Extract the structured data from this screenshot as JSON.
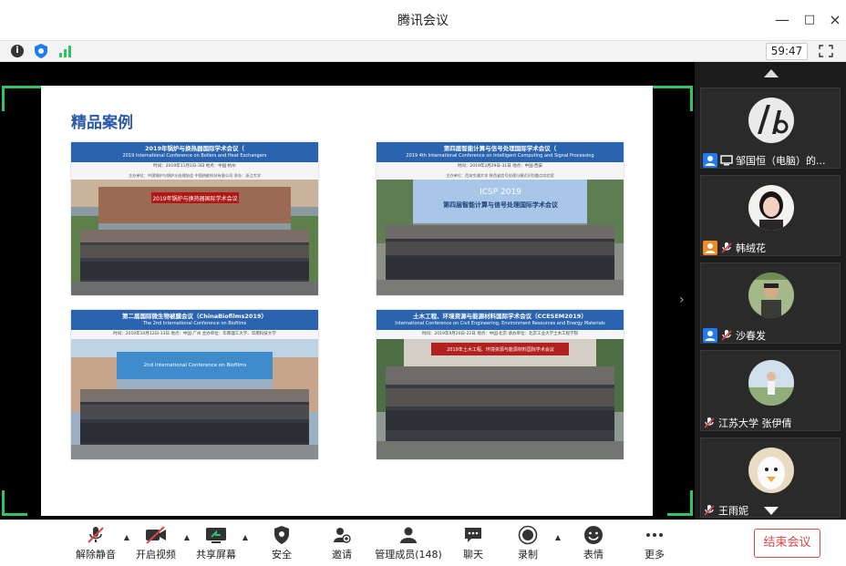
{
  "window": {
    "title": "腾讯会议",
    "min": "—",
    "max": "□",
    "close": "×"
  },
  "toolbar": {
    "timer": "59:47",
    "info": "i"
  },
  "slide": {
    "title": "精品案例",
    "cases": [
      {
        "cn": "2019年锅炉与换热器国际学术会议（",
        "en": "2019 International Conference on Boilers and Heat Exchangers",
        "meta": "时间：2019年11月1日-3日    地点：中国·杭州",
        "meta2": "主办单位：中国锅炉与锅炉水处理协会    中国热能科技有限公司    承办：浙江大学",
        "banner": "2019年锅炉与换热器国际学术会议"
      },
      {
        "cn": "第四届智能计算与信号处理国际学术会议（",
        "en": "2019 4th International Conference on Intelligent Computing and Signal Processing",
        "meta": "时间：2019年3月29日-31日    地点：中国·西安",
        "meta2": "主办单位：西安交通大学    陕西省信号处理与模式识别重点实验室",
        "banner": "ICSP 2019",
        "banner2": "第四届智能计算与信号处理国际学术会议"
      },
      {
        "cn": "第二届国际微生物被膜会议（ChinaBiofilms2019）",
        "en": "The 2nd International Conference on Biofilms",
        "meta": "时间：2019年10月12日-13日    地点：中国·广州    主办单位：华南理工大学、华南科技大学",
        "banner": "2nd International Conference on Biofilms"
      },
      {
        "cn": "土木工程、环境资源与能源材料国际学术会议（CCESEM2019）",
        "en": "International Conference on Civil Engineering, Environment Resources and Energy Materials",
        "meta": "时间：2019年9月20日-22日    地点：中国·北京    承办单位：北京工业大学土木工程学院",
        "banner": "2019年土木工程、环境资源与能源材料国际学术会议"
      }
    ]
  },
  "participants": [
    {
      "name": "邹国恒（电脑）的..."
    },
    {
      "name": "韩绒花"
    },
    {
      "name": "沙春发"
    },
    {
      "name": "江苏大学 张伊倩"
    },
    {
      "name": "王雨妮"
    }
  ],
  "controls": {
    "unmute": "解除静音",
    "start_video": "开启视频",
    "share_screen": "共享屏幕",
    "security": "安全",
    "invite": "邀请",
    "manage_members": "管理成员(148)",
    "chat": "聊天",
    "record": "录制",
    "reactions": "表情",
    "more": "更多",
    "end_meeting": "结束会议"
  },
  "colors": {
    "accent_green": "#2fc566",
    "end_red": "#e04545",
    "slide_blue": "#2a64b0",
    "host_blue": "#1e7cf2",
    "host_orange": "#f08a24"
  }
}
